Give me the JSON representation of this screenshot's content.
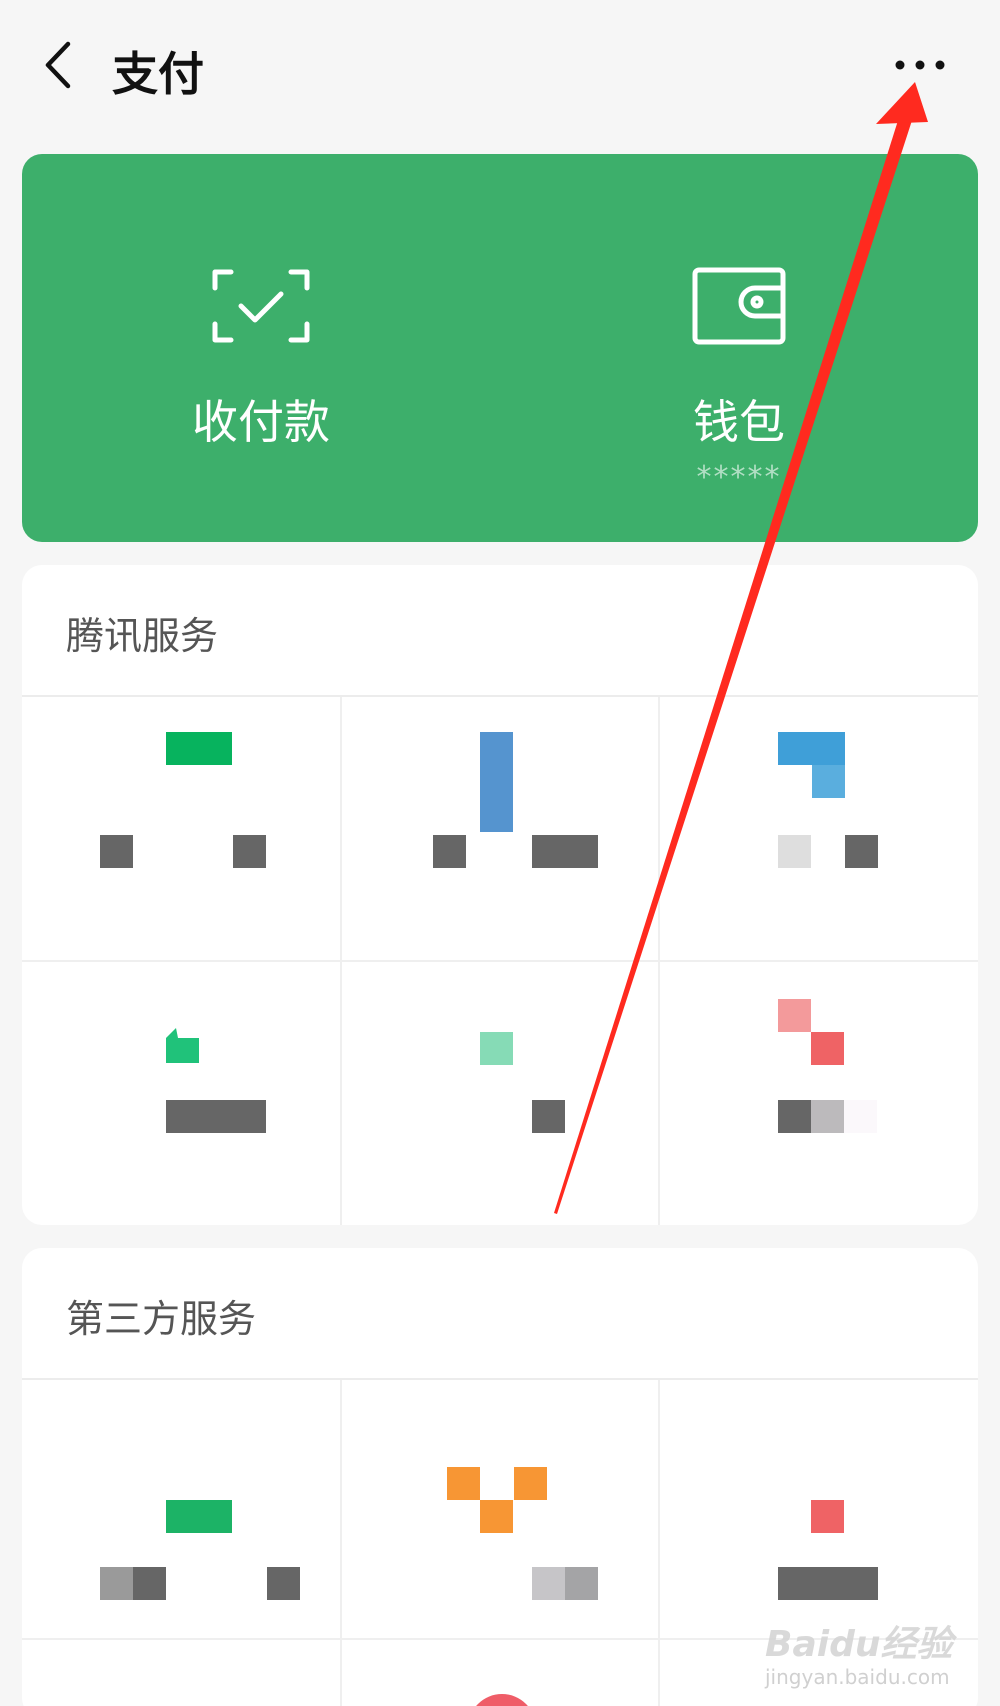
{
  "header": {
    "title": "支付",
    "back_icon": "chevron-left-icon",
    "more_icon": "more-horizontal-icon"
  },
  "green_card": {
    "background": "#3daf6b",
    "items": [
      {
        "label": "收付款",
        "icon": "scan-check-icon"
      },
      {
        "label": "钱包",
        "sub": "*****",
        "icon": "wallet-icon"
      }
    ]
  },
  "sections": {
    "tencent": {
      "title": "腾讯服务"
    },
    "third_party": {
      "title": "第三方服务"
    }
  },
  "annotation": {
    "arrow_color": "#ff2a1f"
  },
  "watermark": {
    "main": "Baidu经验",
    "sub": "jingyan.baidu.com"
  }
}
